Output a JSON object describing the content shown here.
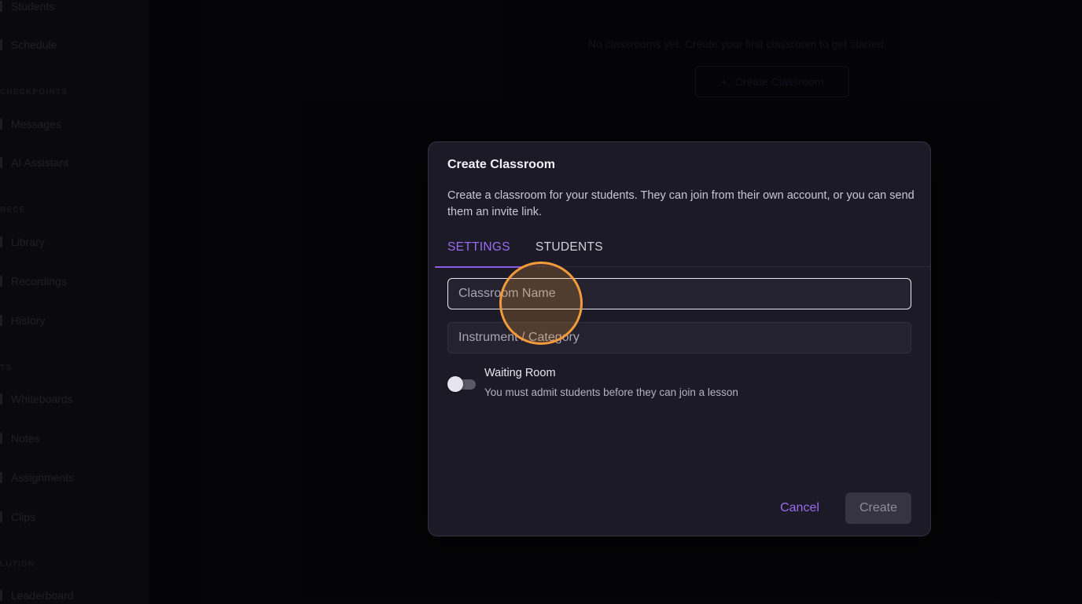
{
  "background": {
    "sidebar": {
      "items": [
        {
          "label": "Students"
        },
        {
          "label": "Schedule"
        },
        {
          "label": "Messages"
        },
        {
          "label": "AI Assistant"
        },
        {
          "label": "Library"
        },
        {
          "label": "Recordings"
        },
        {
          "label": "History"
        },
        {
          "label": "Whiteboards"
        },
        {
          "label": "Notes"
        },
        {
          "label": "Assignments"
        },
        {
          "label": "Clips"
        },
        {
          "label": "Leaderboard"
        }
      ],
      "sections": [
        {
          "label": "CHECKPOINTS"
        },
        {
          "label": "RECE"
        },
        {
          "label": "TS"
        },
        {
          "label": "LUTION"
        }
      ]
    },
    "empty_state_text": "No classrooms yet. Create your first classroom to get started.",
    "create_button_label": "Create Classroom"
  },
  "dialog": {
    "title": "Create Classroom",
    "description": "Create a classroom for your students. They can join from their own account, or you can send them an invite link.",
    "tabs": [
      {
        "label": "SETTINGS",
        "active": true
      },
      {
        "label": "STUDENTS",
        "active": false
      }
    ],
    "name_field": {
      "placeholder": "Classroom Name",
      "value": ""
    },
    "category_field": {
      "placeholder": "Instrument / Category",
      "value": ""
    },
    "waiting_room": {
      "label": "Waiting Room",
      "help": "You must admit students before they can join a lesson",
      "enabled": false
    },
    "cancel_label": "Cancel",
    "create_label": "Create"
  },
  "colors": {
    "accent": "#9a6cf2",
    "dialog_bg": "#1c1a26",
    "click_indicator": "#f39a3c"
  }
}
